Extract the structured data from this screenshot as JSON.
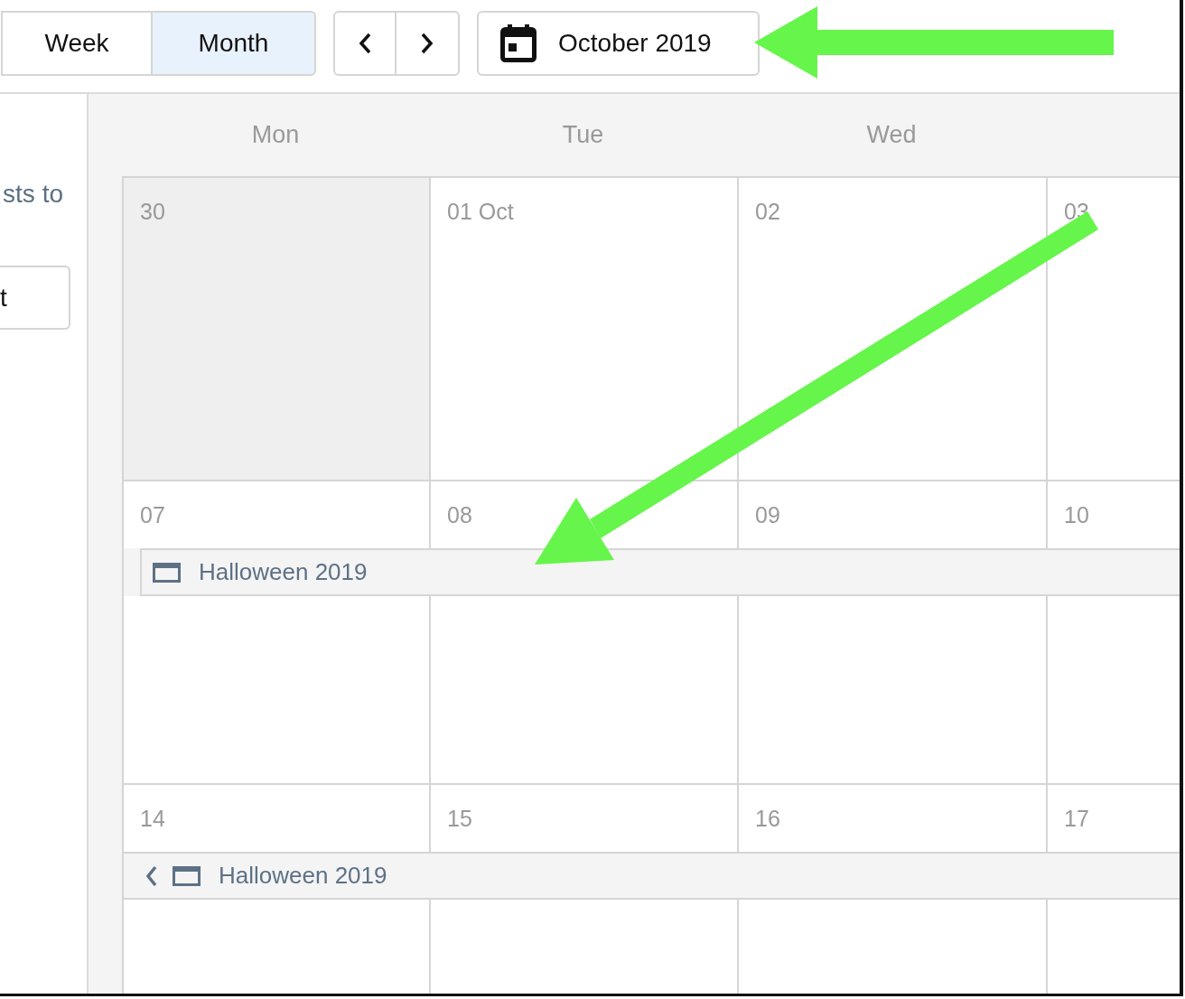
{
  "view_switch": [
    {
      "label": "Week",
      "selected": false
    },
    {
      "label": "Month",
      "selected": true
    }
  ],
  "date_button": {
    "label": "October 2019"
  },
  "sidebar": {
    "text": "sts to",
    "button": "t"
  },
  "weekdays": [
    "Mon",
    "Tue",
    "Wed"
  ],
  "weeks": [
    {
      "days": [
        {
          "label": "30",
          "outside": true
        },
        {
          "label": "01 Oct",
          "outside": false
        },
        {
          "label": "02",
          "outside": false
        },
        {
          "label": "03",
          "outside": false
        }
      ]
    },
    {
      "days": [
        {
          "label": "07",
          "outside": false
        },
        {
          "label": "08",
          "outside": false
        },
        {
          "label": "09",
          "outside": false
        },
        {
          "label": "10",
          "outside": false
        }
      ],
      "events": [
        {
          "title": "Halloween 2019",
          "continued": false
        }
      ]
    },
    {
      "days": [
        {
          "label": "14",
          "outside": false
        },
        {
          "label": "15",
          "outside": false
        },
        {
          "label": "16",
          "outside": false
        },
        {
          "label": "17",
          "outside": false
        }
      ],
      "events": [
        {
          "title": "Halloween 2019",
          "continued": true
        }
      ]
    }
  ]
}
